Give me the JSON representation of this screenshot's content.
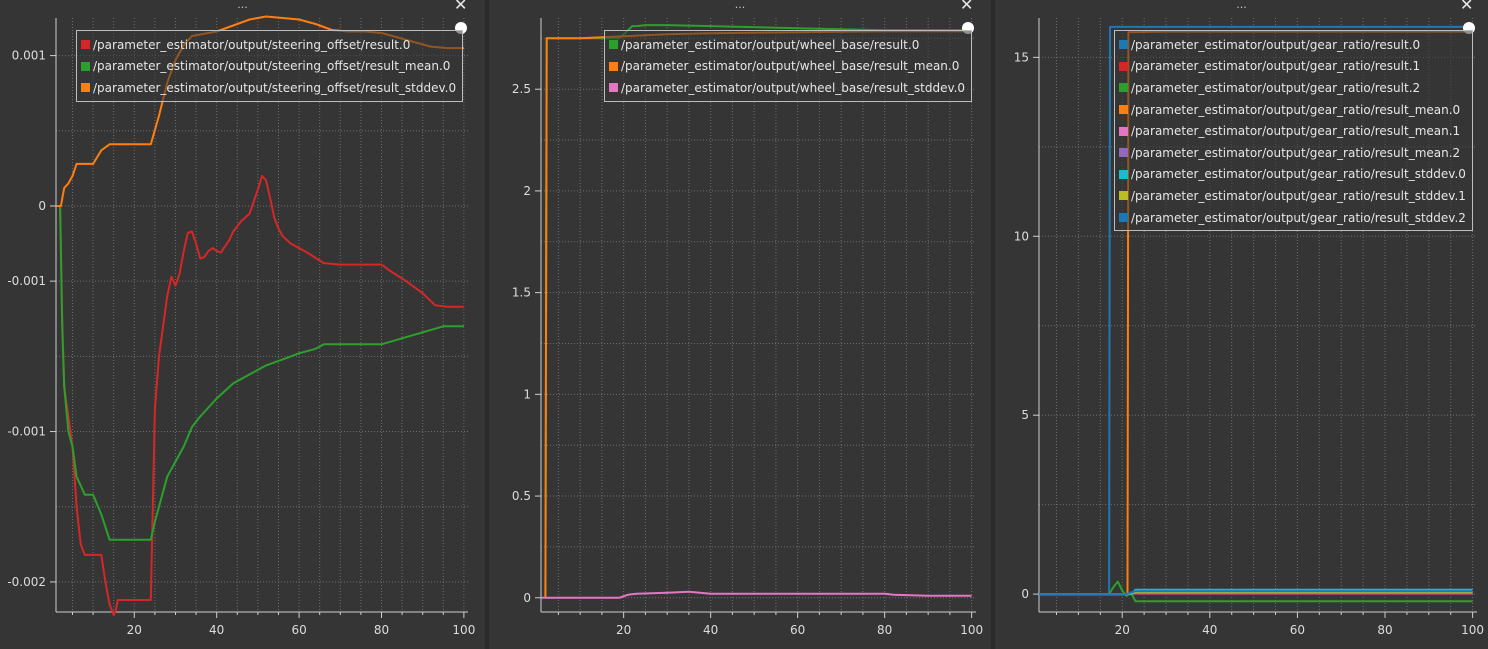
{
  "window": {
    "panel_title": "...",
    "close_glyph": "✕"
  },
  "colors": {
    "background": "#353535",
    "grid": "#6e6e6e",
    "axis": "#cfcfcf",
    "red": "#d62728",
    "green": "#2ca02c",
    "orange": "#ff7f0e",
    "pink": "#e377c2",
    "purple": "#9467bd",
    "cyan": "#17becf",
    "olive": "#bcbd22",
    "blue": "#1f77b4"
  },
  "chart_data": [
    {
      "type": "line",
      "title": "",
      "xlabel": "",
      "ylabel": "",
      "xlim": [
        1,
        101
      ],
      "ylim": [
        -0.0027,
        0.00125
      ],
      "xticks": [
        20,
        40,
        60,
        80,
        100
      ],
      "xtick_labels": [
        "20",
        "40",
        "60",
        "80",
        "100"
      ],
      "yticks": [
        0.001,
        0,
        -0.0005,
        -0.0015,
        -0.0025
      ],
      "ytick_labels": [
        "0.001",
        "0",
        "-0.001",
        "-0.001",
        "-0.002"
      ],
      "grid": true,
      "legend_position": "top-center",
      "series": [
        {
          "name": "/parameter_estimator/output/steering_offset/result.0",
          "color": "red",
          "x": [
            2,
            2.5,
            3,
            4,
            5,
            6,
            7,
            8,
            9,
            10,
            11,
            12,
            13,
            14,
            15,
            15.5,
            16,
            17,
            18,
            20,
            22,
            24,
            24.5,
            25,
            26,
            27,
            28,
            29,
            30,
            31,
            32,
            33,
            34,
            35,
            36,
            37,
            38,
            39,
            40,
            41,
            42,
            43,
            44,
            46,
            48,
            50,
            51,
            52,
            53,
            54,
            55,
            56,
            58,
            60,
            62,
            66,
            70,
            80,
            82,
            86,
            90,
            93,
            96,
            100
          ],
          "y": [
            0,
            -0.00075,
            -0.0012,
            -0.0014,
            -0.0016,
            -0.002,
            -0.00225,
            -0.00232,
            -0.00232,
            -0.00232,
            -0.00232,
            -0.00232,
            -0.0025,
            -0.00265,
            -0.00272,
            -0.00269,
            -0.00262,
            -0.00262,
            -0.00262,
            -0.00262,
            -0.00262,
            -0.00262,
            -0.002,
            -0.00135,
            -0.001,
            -0.0008,
            -0.0006,
            -0.00047,
            -0.00053,
            -0.00045,
            -0.0003,
            -0.00018,
            -0.00017,
            -0.00025,
            -0.00035,
            -0.00034,
            -0.0003,
            -0.00028,
            -0.0003,
            -0.00031,
            -0.00027,
            -0.00023,
            -0.00017,
            -0.0001,
            -5e-05,
            0.00011,
            0.0002,
            0.00017,
            5e-05,
            -8e-05,
            -0.00015,
            -0.0002,
            -0.00025,
            -0.00028,
            -0.00031,
            -0.00038,
            -0.00039,
            -0.00039,
            -0.00043,
            -0.0005,
            -0.00058,
            -0.00066,
            -0.00067,
            -0.00067
          ]
        },
        {
          "name": "/parameter_estimator/output/steering_offset/result_mean.0",
          "color": "green",
          "x": [
            2,
            2.5,
            3,
            4,
            5,
            6,
            8,
            10,
            12,
            14,
            16,
            18,
            20,
            22,
            24,
            25,
            26,
            28,
            30,
            32,
            34,
            36,
            40,
            44,
            48,
            52,
            56,
            60,
            64,
            66,
            70,
            80,
            85,
            90,
            95,
            100
          ],
          "y": [
            0,
            -0.0008,
            -0.0012,
            -0.0015,
            -0.0016,
            -0.0018,
            -0.00192,
            -0.00192,
            -0.00205,
            -0.00222,
            -0.00222,
            -0.00222,
            -0.00222,
            -0.00222,
            -0.00222,
            -0.0021,
            -0.002,
            -0.0018,
            -0.0017,
            -0.0016,
            -0.00147,
            -0.0014,
            -0.00128,
            -0.00118,
            -0.00112,
            -0.00106,
            -0.00102,
            -0.00098,
            -0.00095,
            -0.00092,
            -0.00092,
            -0.00092,
            -0.00088,
            -0.00084,
            -0.0008,
            -0.0008
          ]
        },
        {
          "name": "/parameter_estimator/output/steering_offset/result_stddev.0",
          "color": "orange",
          "x": [
            1.2,
            2.2,
            3,
            4,
            5,
            6,
            8,
            10,
            12,
            14,
            16,
            18,
            20,
            22,
            24,
            26,
            28,
            30,
            32,
            34,
            36,
            40,
            44,
            48,
            52,
            56,
            60,
            64,
            68,
            72,
            76,
            80,
            84,
            88,
            92,
            96,
            100
          ],
          "y": [
            0,
            0,
            0.00012,
            0.00015,
            0.0002,
            0.00028,
            0.00028,
            0.00028,
            0.00037,
            0.00041,
            0.00041,
            0.00041,
            0.00041,
            0.00041,
            0.00041,
            0.0006,
            0.00082,
            0.00097,
            0.00107,
            0.00113,
            0.00114,
            0.00116,
            0.0012,
            0.00124,
            0.00126,
            0.00125,
            0.00124,
            0.00121,
            0.00117,
            0.00116,
            0.00116,
            0.00115,
            0.00112,
            0.00109,
            0.00106,
            0.00105,
            0.00105
          ]
        }
      ]
    },
    {
      "type": "line",
      "title": "",
      "xlabel": "",
      "ylabel": "",
      "xlim": [
        1,
        101
      ],
      "ylim": [
        -0.07,
        2.85
      ],
      "xticks": [
        20,
        40,
        60,
        80,
        100
      ],
      "xtick_labels": [
        "20",
        "40",
        "60",
        "80",
        "100"
      ],
      "yticks": [
        0,
        0.5,
        1,
        1.5,
        2,
        2.5
      ],
      "ytick_labels": [
        "0",
        "0.5",
        "1",
        "1.5",
        "2",
        "2.5"
      ],
      "grid": true,
      "legend_position": "top-center",
      "series": [
        {
          "name": "/parameter_estimator/output/wheel_base/result.0",
          "color": "green",
          "x": [
            2,
            2.3,
            8,
            19,
            20,
            21,
            22,
            23,
            25,
            30,
            40,
            60,
            80,
            90,
            100
          ],
          "y": [
            0,
            2.75,
            2.75,
            2.75,
            2.77,
            2.79,
            2.81,
            2.81,
            2.815,
            2.815,
            2.81,
            2.8,
            2.79,
            2.79,
            2.79
          ]
        },
        {
          "name": "/parameter_estimator/output/wheel_base/result_mean.0",
          "color": "orange",
          "x": [
            2,
            2.3,
            10,
            20,
            25,
            30,
            40,
            60,
            80,
            100
          ],
          "y": [
            0,
            2.75,
            2.75,
            2.76,
            2.765,
            2.77,
            2.775,
            2.78,
            2.785,
            2.785
          ]
        },
        {
          "name": "/parameter_estimator/output/wheel_base/result_stddev.0",
          "color": "pink",
          "x": [
            1.2,
            10,
            19,
            21,
            23,
            30,
            35,
            40,
            60,
            80,
            82,
            90,
            100
          ],
          "y": [
            0,
            0,
            0,
            0.015,
            0.02,
            0.025,
            0.03,
            0.02,
            0.02,
            0.02,
            0.015,
            0.01,
            0.01
          ]
        }
      ]
    },
    {
      "type": "line",
      "title": "",
      "xlabel": "",
      "ylabel": "",
      "xlim": [
        1,
        101
      ],
      "ylim": [
        -0.5,
        16.1
      ],
      "xticks": [
        20,
        40,
        60,
        80,
        100
      ],
      "xtick_labels": [
        "20",
        "40",
        "60",
        "80",
        "100"
      ],
      "yticks": [
        0,
        5,
        10,
        15
      ],
      "ytick_labels": [
        "0",
        "5",
        "10",
        "15"
      ],
      "grid": true,
      "legend_position": "top-center",
      "series": [
        {
          "name": "/parameter_estimator/output/gear_ratio/result.0",
          "color": "blue",
          "x": [
            1,
            17,
            17.2,
            100
          ],
          "y": [
            0,
            0,
            15.85,
            15.85
          ]
        },
        {
          "name": "/parameter_estimator/output/gear_ratio/result.1",
          "color": "red",
          "x": [
            1,
            21,
            22,
            24,
            100
          ],
          "y": [
            0,
            0,
            0.02,
            0.01,
            0.01
          ]
        },
        {
          "name": "/parameter_estimator/output/gear_ratio/result.2",
          "color": "green",
          "x": [
            1,
            17,
            18,
            19,
            20,
            21,
            22,
            23,
            25,
            40,
            100
          ],
          "y": [
            0,
            0,
            0.2,
            0.35,
            0.1,
            -0.05,
            0.05,
            -0.2,
            -0.2,
            -0.2,
            -0.2
          ]
        },
        {
          "name": "/parameter_estimator/output/gear_ratio/result_mean.0",
          "color": "orange",
          "x": [
            1,
            21.2,
            21.4,
            30,
            60,
            100
          ],
          "y": [
            0,
            0,
            15.7,
            15.72,
            15.72,
            15.72
          ]
        },
        {
          "name": "/parameter_estimator/output/gear_ratio/result_mean.1",
          "color": "pink",
          "x": [
            1,
            21,
            23,
            100
          ],
          "y": [
            0,
            0,
            0.03,
            0.03
          ]
        },
        {
          "name": "/parameter_estimator/output/gear_ratio/result_mean.2",
          "color": "purple",
          "x": [
            1,
            21,
            23,
            100
          ],
          "y": [
            0,
            0,
            0.02,
            0.02
          ]
        },
        {
          "name": "/parameter_estimator/output/gear_ratio/result_stddev.0",
          "color": "cyan",
          "x": [
            1,
            22,
            23,
            100
          ],
          "y": [
            0,
            0,
            0.12,
            0.12
          ]
        },
        {
          "name": "/parameter_estimator/output/gear_ratio/result_stddev.1",
          "color": "olive",
          "x": [
            1,
            21,
            23,
            100
          ],
          "y": [
            0,
            0,
            0.05,
            0.05
          ]
        },
        {
          "name": "/parameter_estimator/output/gear_ratio/result_stddev.2",
          "color": "blue",
          "x": [
            1,
            21,
            23,
            100
          ],
          "y": [
            0,
            0,
            0.08,
            0.08
          ]
        }
      ]
    }
  ]
}
